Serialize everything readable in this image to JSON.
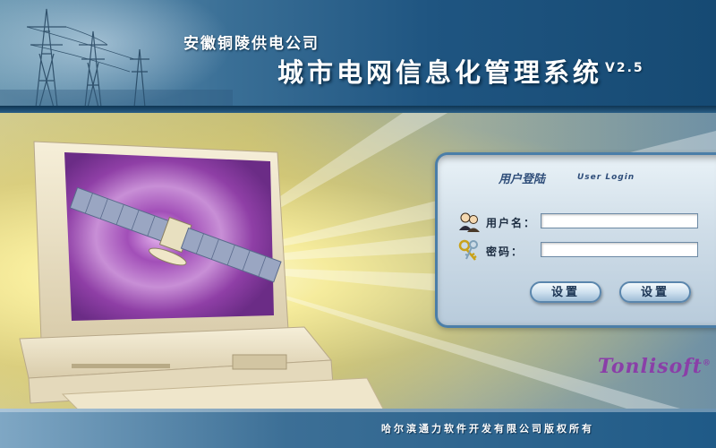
{
  "header": {
    "company": "安徽铜陵供电公司",
    "system_title": "城市电网信息化管理系统",
    "version": "V2.5"
  },
  "login": {
    "title": "用户登陆",
    "title_en": "User Login",
    "username_label": "用户名：",
    "username_value": "",
    "password_label": "密码：",
    "password_value": "",
    "button_left_label": "设置",
    "button_right_label": "设置",
    "username_icon": "users-icon",
    "password_icon": "keys-icon"
  },
  "logo": {
    "text": "Tonlisoft",
    "reg": "®"
  },
  "footer": {
    "copyright": "哈尔滨通力软件开发有限公司版权所有"
  },
  "colors": {
    "header_blue": "#1f5581",
    "panel_border": "#4b7ea8",
    "logo_purple": "#8a3fa8",
    "background_yellow": "#e8d98a"
  }
}
